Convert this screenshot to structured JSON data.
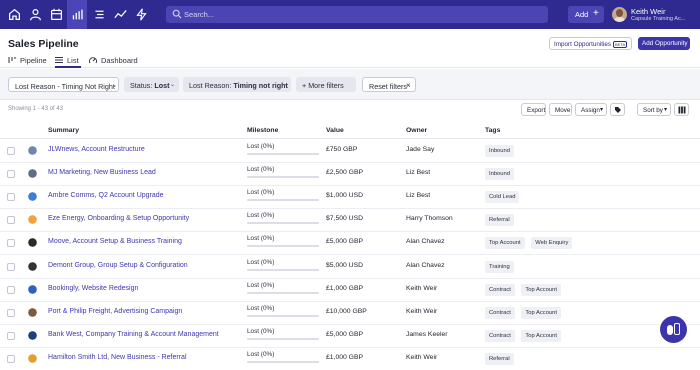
{
  "search": {
    "placeholder": "Search..."
  },
  "topbar": {
    "add_label": "Add",
    "add_plus": "+",
    "user_name": "Keith Weir",
    "user_org": "Capsule Training Ac..."
  },
  "page": {
    "title": "Sales Pipeline",
    "import_label": "Import Opportunities",
    "beta": "BETA",
    "add_opportunity": "Add Opportunity"
  },
  "tabs": [
    {
      "label": "Pipeline",
      "icon": "pipeline-icon"
    },
    {
      "label": "List",
      "icon": "list-icon",
      "active": true
    },
    {
      "label": "Dashboard",
      "icon": "dashboard-icon"
    }
  ],
  "filters": {
    "lost_reason_chip": "Lost Reason - Timing Not Right",
    "status": "Status:",
    "status_value": "Lost",
    "lost_reason": "Lost Reason:",
    "lost_reason_value": "Timing not right",
    "more_filters": "+ More filters",
    "reset": "Reset filters",
    "reset_x": "×"
  },
  "toolbar": {
    "showing": "Showing 1 - 43 of 43",
    "export": "Export",
    "move": "Move",
    "assign": "Assign",
    "sort_by": "Sort by"
  },
  "columns": {
    "summary": "Summary",
    "milestone": "Milestone",
    "value": "Value",
    "owner": "Owner",
    "tags": "Tags"
  },
  "rows": [
    {
      "summary": "JLWnews, Account Restructure",
      "milestone": "Lost (0%)",
      "value": "£750 GBP",
      "owner": "Jade Say",
      "tags": [
        "Inbound"
      ],
      "logo_color": "#6f87a8"
    },
    {
      "summary": "MJ Marketing, New Business Lead",
      "milestone": "Lost (0%)",
      "value": "£2,500 GBP",
      "owner": "Liz Best",
      "tags": [
        "Inbound"
      ],
      "logo_color": "#5d6f86"
    },
    {
      "summary": "Ambre Comms, Q2 Account Upgrade",
      "milestone": "Lost (0%)",
      "value": "$1,000 USD",
      "owner": "Liz Best",
      "tags": [
        "Cold Lead"
      ],
      "logo_color": "#3b7dd8"
    },
    {
      "summary": "Eze Energy, Onboarding & Setup Opportunity",
      "milestone": "Lost (0%)",
      "value": "$7,500 USD",
      "owner": "Harry Thomson",
      "tags": [
        "Referral"
      ],
      "logo_color": "#f2a23a"
    },
    {
      "summary": "Moove, Account Setup & Business Training",
      "milestone": "Lost (0%)",
      "value": "£5,000 GBP",
      "owner": "Alan Chavez",
      "tags": [
        "Top Account",
        "Web Enquiry"
      ],
      "logo_color": "#2a2a2a"
    },
    {
      "summary": "Demont Group, Group Setup & Configuration",
      "milestone": "Lost (0%)",
      "value": "$5,000 USD",
      "owner": "Alan Chavez",
      "tags": [
        "Training"
      ],
      "logo_color": "#333333"
    },
    {
      "summary": "Bookingly, Website Redesign",
      "milestone": "Lost (0%)",
      "value": "£1,000 GBP",
      "owner": "Keith Weir",
      "tags": [
        "Contract",
        "Top Account"
      ],
      "logo_color": "#2f5fbf"
    },
    {
      "summary": "Port & Philip Freight, Advertising Campaign",
      "milestone": "Lost (0%)",
      "value": "£10,000 GBP",
      "owner": "Keith Weir",
      "tags": [
        "Contract",
        "Top Account"
      ],
      "logo_color": "#7d5a3f"
    },
    {
      "summary": "Bank West, Company Training & Account Management",
      "milestone": "Lost (0%)",
      "value": "£5,000 GBP",
      "owner": "James Keeler",
      "tags": [
        "Contract",
        "Top Account"
      ],
      "logo_color": "#1f3f7a"
    },
    {
      "summary": "Hamilton Smith Ltd, New Business - Referral",
      "milestone": "Lost (0%)",
      "value": "£1,000 GBP",
      "owner": "Keith Weir",
      "tags": [
        "Referral"
      ],
      "logo_color": "#e0a030"
    }
  ]
}
